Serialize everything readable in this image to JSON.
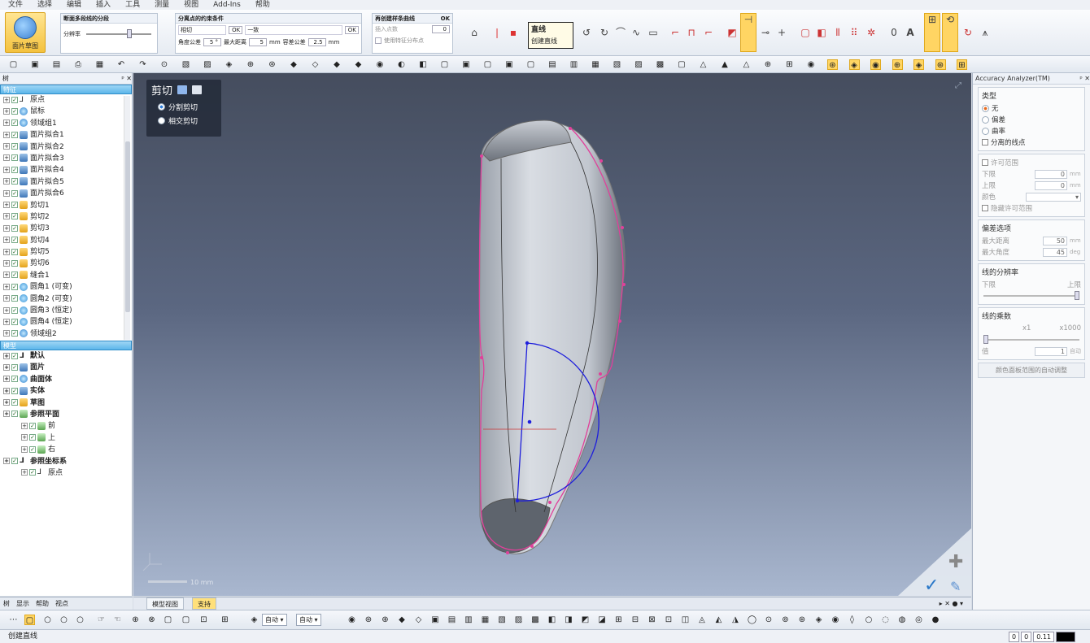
{
  "menu": [
    "文件",
    "选择",
    "编辑",
    "插入",
    "工具",
    "测量",
    "视图",
    "Add-Ins",
    "帮助"
  ],
  "ribbon": {
    "big_button": "面片草图",
    "group1": {
      "title": "断面多段线的分段",
      "label": "分辨率"
    },
    "group2": {
      "title": "分离点的约束条件",
      "sub1": "相切",
      "sub2": "一致",
      "ok": "OK",
      "angle_label": "角度公差",
      "angle_value": "5 °",
      "dist_label": "最大距离",
      "dist_value": "5",
      "dist_unit": "mm",
      "tol_label": "容差公差",
      "tol_value": "2.5",
      "tol_unit": "mm"
    },
    "group3": {
      "title": "再创建样条曲线",
      "ok": "OK",
      "insert_label": "插入点数",
      "insert_value": "0",
      "check_label": "使用特征分布点"
    },
    "tooltip": {
      "title": "直线",
      "desc": "创建直线"
    }
  },
  "left_panel": {
    "title": "树",
    "feature_header": "特征",
    "features": [
      {
        "label": "原点",
        "icon": "origin-icon",
        "t": "none"
      },
      {
        "label": "鼠标",
        "icon": "mesh-icon",
        "t": "dot"
      },
      {
        "label": "领域组1",
        "icon": "region-icon",
        "t": "dot"
      },
      {
        "label": "面片拟合1",
        "icon": "face-fit-icon",
        "t": "face"
      },
      {
        "label": "面片拟合2",
        "icon": "face-fit-icon",
        "t": "face"
      },
      {
        "label": "面片拟合3",
        "icon": "face-fit-icon",
        "t": "face"
      },
      {
        "label": "面片拟合4",
        "icon": "face-fit-icon",
        "t": "face"
      },
      {
        "label": "面片拟合5",
        "icon": "face-fit-icon",
        "t": "face"
      },
      {
        "label": "面片拟合6",
        "icon": "face-fit-icon",
        "t": "face"
      },
      {
        "label": "剪切1",
        "icon": "cut-icon",
        "t": "cut"
      },
      {
        "label": "剪切2",
        "icon": "cut-icon",
        "t": "cut"
      },
      {
        "label": "剪切3",
        "icon": "cut-icon",
        "t": "cut"
      },
      {
        "label": "剪切4",
        "icon": "cut-icon",
        "t": "cut"
      },
      {
        "label": "剪切5",
        "icon": "cut-icon",
        "t": "cut"
      },
      {
        "label": "剪切6",
        "icon": "cut-icon",
        "t": "cut"
      },
      {
        "label": "缝合1",
        "icon": "stitch-icon",
        "t": "cut"
      },
      {
        "label": "圆角1 (可变)",
        "icon": "fillet-icon",
        "t": "round"
      },
      {
        "label": "圆角2 (可变)",
        "icon": "fillet-icon",
        "t": "round"
      },
      {
        "label": "圆角3 (恒定)",
        "icon": "fillet-icon",
        "t": "round"
      },
      {
        "label": "圆角4 (恒定)",
        "icon": "fillet-icon",
        "t": "round"
      },
      {
        "label": "领域组2",
        "icon": "region-icon",
        "t": "dot"
      }
    ],
    "model_header": "模型",
    "model": [
      {
        "label": "默认",
        "level": 0,
        "bold": true,
        "t": "none"
      },
      {
        "label": "面片",
        "level": 0,
        "bold": true,
        "t": "face"
      },
      {
        "label": "曲面体",
        "level": 0,
        "bold": true,
        "t": "dot"
      },
      {
        "label": "实体",
        "level": 0,
        "bold": true,
        "t": "face"
      },
      {
        "label": "草图",
        "level": 0,
        "bold": true,
        "t": "cut"
      },
      {
        "label": "参照平面",
        "level": 0,
        "bold": true,
        "t": "plane"
      },
      {
        "label": "前",
        "level": 1,
        "bold": false,
        "t": "plane"
      },
      {
        "label": "上",
        "level": 1,
        "bold": false,
        "t": "plane"
      },
      {
        "label": "右",
        "level": 1,
        "bold": false,
        "t": "plane"
      },
      {
        "label": "参照坐标系",
        "level": 0,
        "bold": true,
        "t": "none"
      },
      {
        "label": "原点",
        "level": 1,
        "bold": false,
        "t": "none"
      }
    ],
    "tabs": [
      "树",
      "显示",
      "帮助",
      "视点"
    ]
  },
  "viewport": {
    "op_title": "剪切",
    "options": [
      {
        "label": "分割剪切",
        "on": true
      },
      {
        "label": "相交剪切",
        "on": false
      }
    ],
    "scale_label": "10 mm",
    "tabs": [
      "模型视图",
      "支持"
    ]
  },
  "right_panel": {
    "title": "Accuracy Analyzer(TM)",
    "type_title": "类型",
    "type_options": [
      {
        "label": "无",
        "on": true
      },
      {
        "label": "偏差",
        "on": false
      },
      {
        "label": "曲率",
        "on": false
      }
    ],
    "separated_points": "分离的线点",
    "range_title": "许可范围",
    "lower_label": "下限",
    "lower_value": "0",
    "upper_label": "上限",
    "upper_value": "0",
    "unit_mm": "mm",
    "color_label": "颜色",
    "hide_range": "隐藏许可范围",
    "dev_title": "偏差选项",
    "max_dist_label": "最大距离",
    "max_dist_value": "50",
    "max_angle_label": "最大角度",
    "max_angle_value": "45",
    "unit_deg": "deg",
    "res_title": "线的分辨率",
    "res_low": "下限",
    "res_high": "上限",
    "mult_title": "线的乘数",
    "mult_low": "x1",
    "mult_high": "x1000",
    "value_label": "值",
    "value": "1",
    "auto": "自动",
    "auto_adjust": "颜色面板范围的自动调整"
  },
  "bottom_toolbar": {
    "dd1": "自动",
    "dd2": "自动"
  },
  "status": {
    "text": "创建直线",
    "c1": "0",
    "c2": "0",
    "c3": "0.11"
  },
  "colors": {
    "accent": "#ffd563",
    "selection": "#2f8cc8",
    "curve": "#1f1fdc",
    "edge": "#e0409a"
  }
}
